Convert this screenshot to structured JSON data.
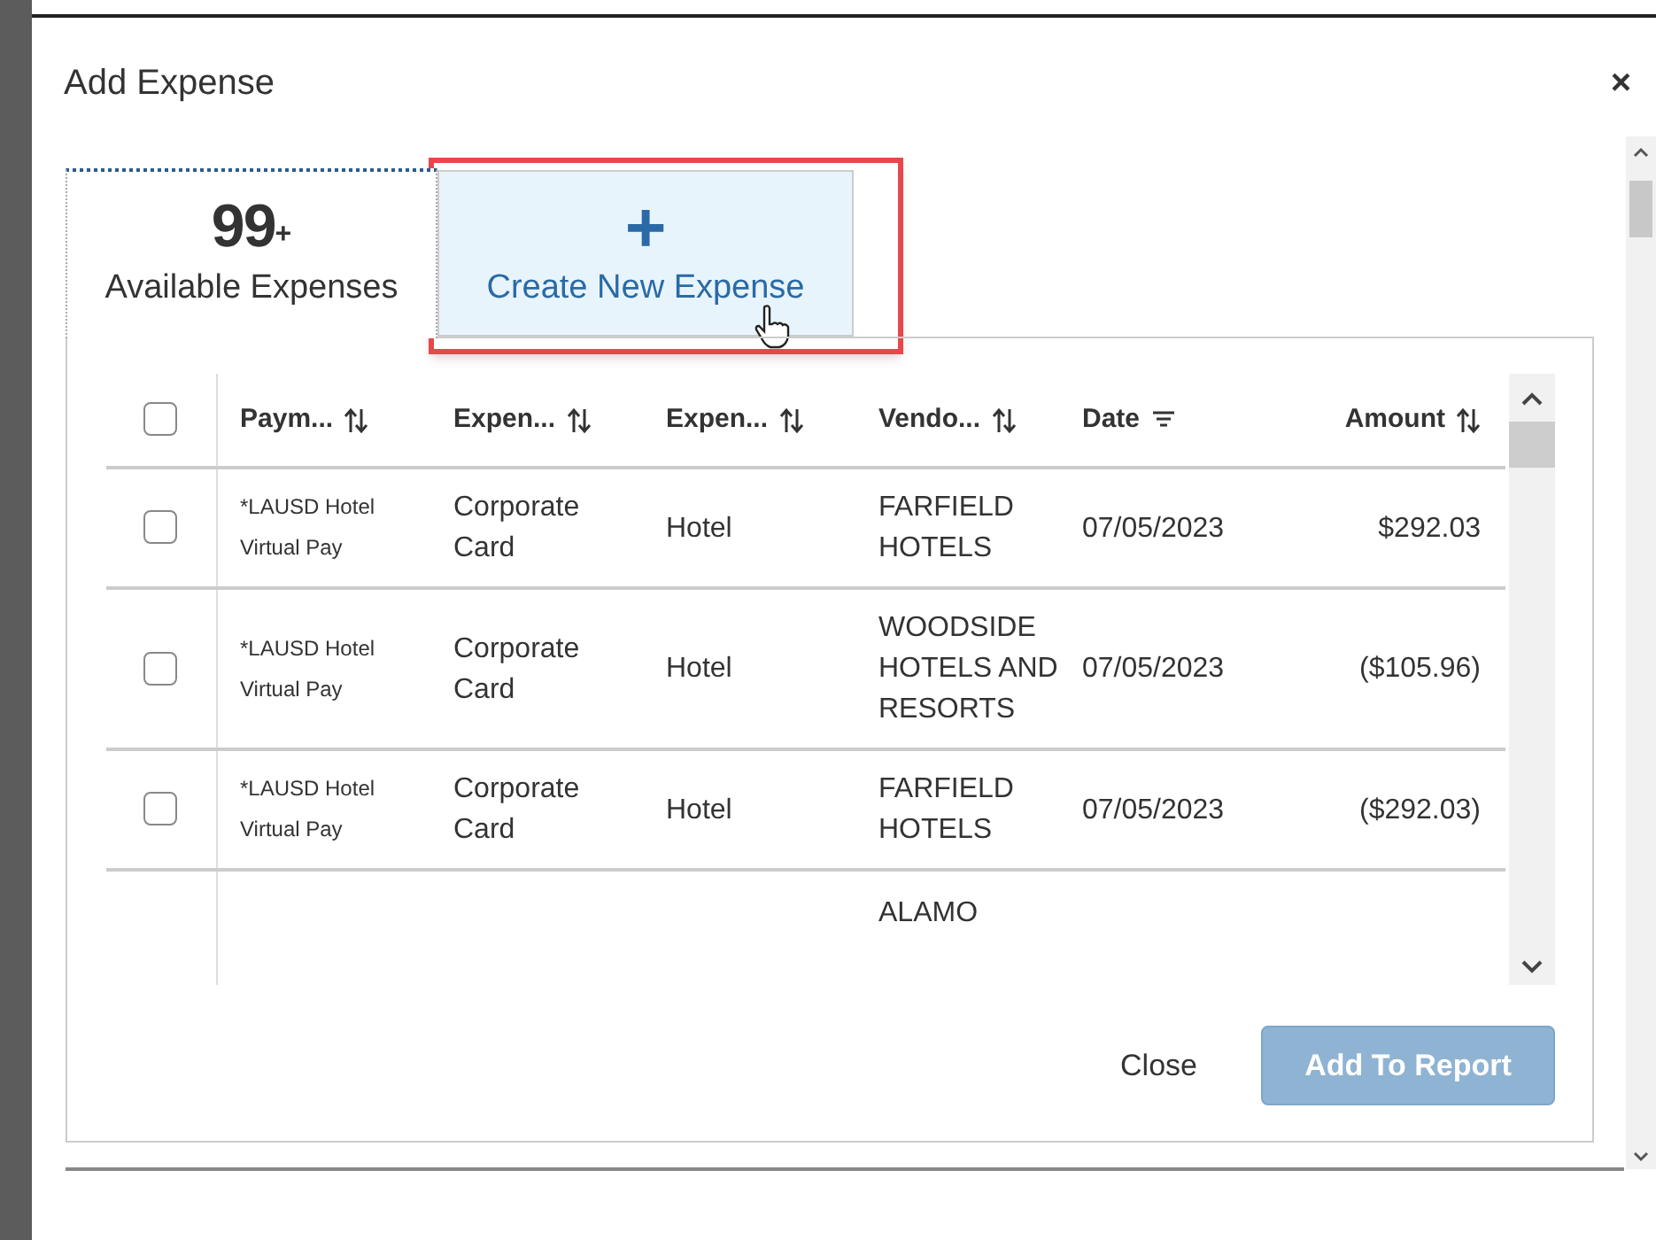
{
  "dialog": {
    "title": "Add Expense",
    "close": "×"
  },
  "tabs": [
    {
      "kind": "count",
      "count": "99",
      "suffix": "+",
      "label": "Available Expenses",
      "selected": true
    },
    {
      "kind": "create",
      "icon": "+",
      "label": "Create New Expense",
      "selected": false
    }
  ],
  "table": {
    "select_all": {
      "checked": false
    },
    "columns": [
      {
        "label": "Paym...",
        "kind": "sort"
      },
      {
        "label": "Expen...",
        "kind": "sort"
      },
      {
        "label": "Expen...",
        "kind": "sort"
      },
      {
        "label": "Vendo...",
        "kind": "sort"
      },
      {
        "label": "Date",
        "kind": "filter"
      },
      {
        "label": "Amount",
        "kind": "sort"
      }
    ],
    "rows": [
      {
        "checked": false,
        "cells": [
          "*LAUSD Hotel Virtual Pay",
          "Corporate Card",
          "Hotel",
          "FARFIELD HOTELS",
          "07/05/2023",
          "$292.03"
        ]
      },
      {
        "checked": false,
        "cells": [
          "*LAUSD Hotel Virtual Pay",
          "Corporate Card",
          "Hotel",
          "WOODSIDE HOTELS AND RESORTS",
          "07/05/2023",
          "($105.96)"
        ]
      },
      {
        "checked": false,
        "cells": [
          "*LAUSD Hotel Virtual Pay",
          "Corporate Card",
          "Hotel",
          "FARFIELD HOTELS",
          "07/05/2023",
          "($292.03)"
        ]
      },
      {
        "partial": true,
        "cells": [
          "",
          "",
          "",
          "ALAMO",
          "",
          ""
        ]
      }
    ]
  },
  "footer": {
    "buttons": [
      {
        "label": "Close",
        "kind": "link",
        "disabled": false
      },
      {
        "label": "Add To Report",
        "kind": "primary",
        "disabled": true
      }
    ]
  }
}
